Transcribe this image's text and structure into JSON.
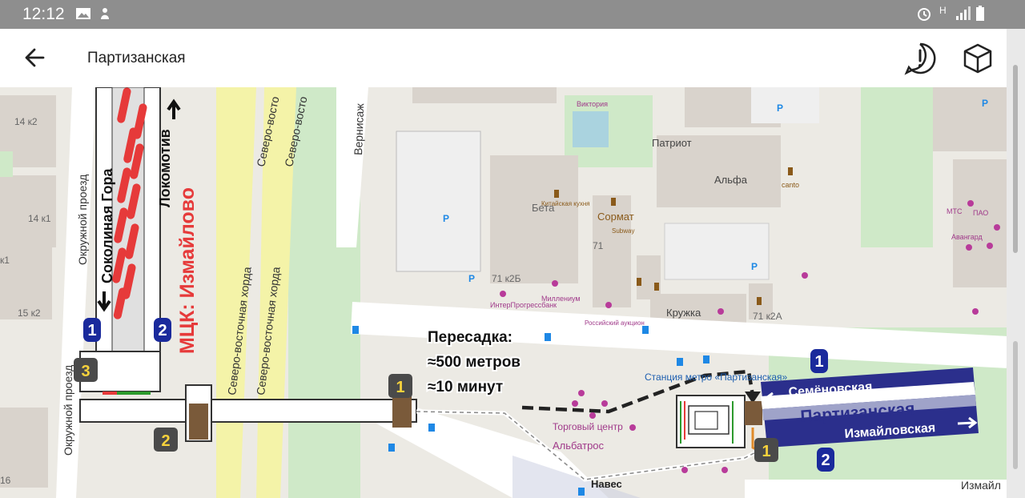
{
  "status_bar": {
    "time": "12:12",
    "icons": [
      "image-icon",
      "android-debug-icon",
      "alarm-icon",
      "signal-icon",
      "battery-icon"
    ],
    "network": "H"
  },
  "app_bar": {
    "title": "Партизанская",
    "back_icon": "arrow-left-icon",
    "report_icon": "exclamation-circle-icon",
    "view3d_icon": "cube-icon"
  },
  "colors": {
    "platform_blue": "#2b2f8c",
    "red_line": "#e63a3a",
    "badge_dark": "#4a4a4a",
    "badge_yellow": "#f7d23c",
    "road_yellow": "#f4f3a8",
    "park_green": "#cfe9c8"
  },
  "map": {
    "transfer": {
      "title": "Пересадка:",
      "distance": "≈500 метров",
      "time": "≈10 минут"
    },
    "mck": {
      "station": "МЦК: Измайлово",
      "track_left": "Соколиная Гора",
      "track_right": "Локомотив",
      "track1_num": "1",
      "track2_num": "2"
    },
    "metro": {
      "station": "Партизанская",
      "dir_left": "Семёновская",
      "dir_right": "Измайловская",
      "platform1": "1",
      "platform2": "2"
    },
    "exits": [
      "1",
      "2",
      "3",
      "1",
      "1"
    ],
    "roads": {
      "okruzhnoy1": "Окружной проезд",
      "okruzhnoy2": "Окружной проезд",
      "hord1": "Северо-восточная хорда",
      "hord2": "Северо-восточная хорда",
      "hord3": "Северо-восто",
      "hord4": "Северо-восто",
      "vernisazh": "Вернисаж",
      "izmayl": "Измайл",
      "naves": "Навес"
    },
    "buildings": {
      "b14k2": "14 к2",
      "b14k1": "14 к1",
      "b15k2": "15 к2",
      "bk1": "к1",
      "b16": "16",
      "beta": "Бета",
      "b71k2b": "71 к2Б",
      "sormat": "Сормат",
      "b71": "71",
      "patriot": "Патриот",
      "alfa": "Альфа",
      "kruzhka": "Кружка",
      "b71k2a": "71 к2А",
      "canto": "canto",
      "victoria": "Виктория",
      "mts": "МТС",
      "pao": "ПАО",
      "avangard": "Авангард",
      "inter": "ИнтерПрогрессбанк",
      "millenium": "Миллениум",
      "kitay": "Китайская кухня",
      "subway": "Subway",
      "rosbank": "Российский аукцион",
      "albatros": "Альбатрос",
      "torg": "Торговый центр",
      "station_label": "Станция метро «Партизанская»"
    },
    "parking": "P"
  }
}
